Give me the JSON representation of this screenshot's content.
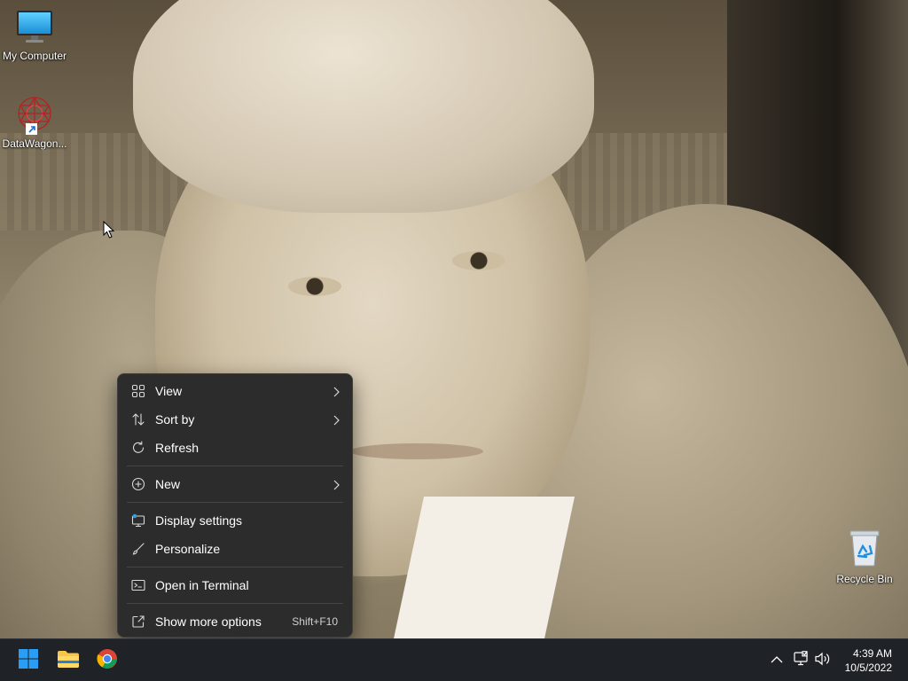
{
  "desktop": {
    "icons": [
      {
        "label": "My Computer",
        "icon": "monitor-icon"
      },
      {
        "label": "DataWagon...",
        "icon": "datawagon-app-icon"
      },
      {
        "label": "Recycle Bin",
        "icon": "recycle-bin-icon"
      }
    ]
  },
  "context_menu": {
    "items": [
      {
        "label": "View",
        "icon": "grid-view-icon",
        "has_submenu": true
      },
      {
        "label": "Sort by",
        "icon": "sort-icon",
        "has_submenu": true
      },
      {
        "label": "Refresh",
        "icon": "refresh-icon",
        "has_submenu": false
      },
      {
        "label": "New",
        "icon": "plus-circle-icon",
        "has_submenu": true
      },
      {
        "label": "Display settings",
        "icon": "display-settings-icon",
        "has_submenu": false
      },
      {
        "label": "Personalize",
        "icon": "brush-icon",
        "has_submenu": false
      },
      {
        "label": "Open in Terminal",
        "icon": "terminal-icon",
        "has_submenu": false
      },
      {
        "label": "Show more options",
        "icon": "open-external-icon",
        "shortcut": "Shift+F10"
      }
    ]
  },
  "taskbar": {
    "pinned": [
      {
        "name": "Start",
        "icon": "windows-start-icon"
      },
      {
        "name": "File Explorer",
        "icon": "folder-icon"
      },
      {
        "name": "Google Chrome",
        "icon": "chrome-icon"
      }
    ],
    "tray": [
      "chevron-up-icon",
      "network-icon",
      "volume-icon"
    ],
    "clock": {
      "time": "4:39 AM",
      "date": "10/5/2022"
    }
  },
  "colors": {
    "menu_bg": "#2c2c2c",
    "taskbar_bg": "#1f2226",
    "start_blue": "#2a9df4",
    "folder_yellow": "#f5c64a"
  }
}
